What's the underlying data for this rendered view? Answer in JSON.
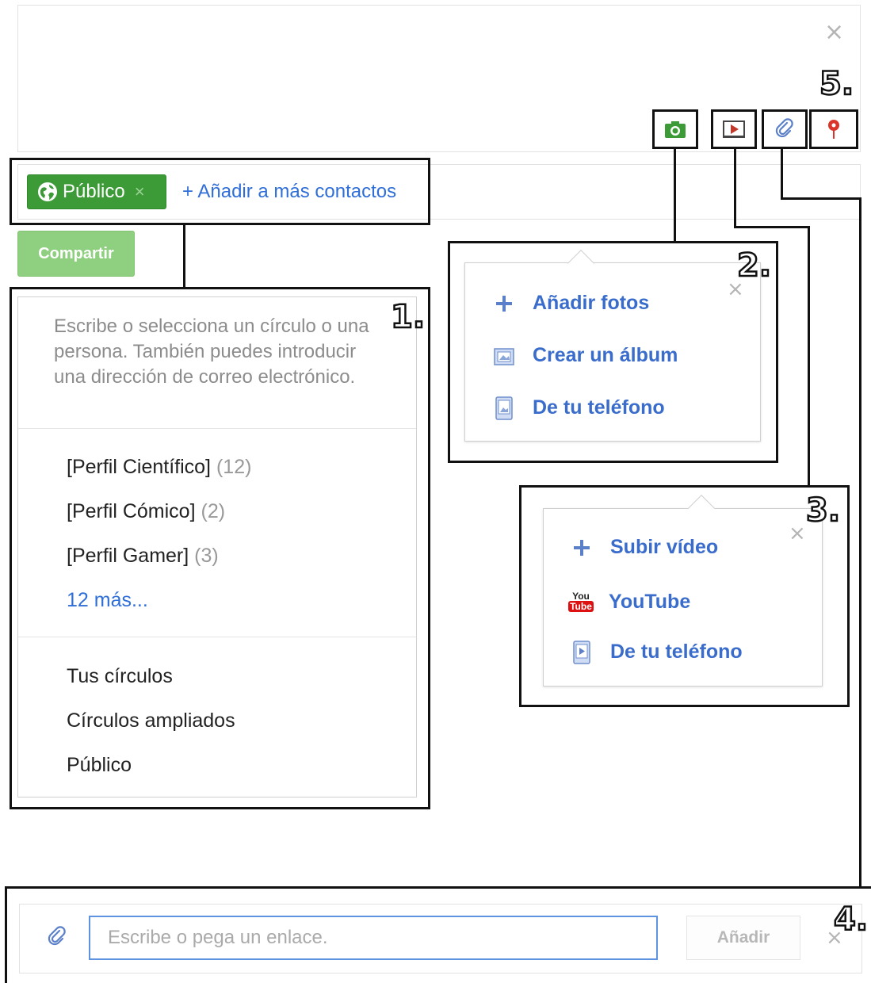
{
  "compose": {
    "close_symbol": "×",
    "toolbar": [
      {
        "name": "camera",
        "icon": "camera-icon",
        "color": "#3c9a37"
      },
      {
        "name": "video",
        "icon": "video-icon",
        "color": "#c0392b"
      },
      {
        "name": "link",
        "icon": "link-icon",
        "color": "#5b80c9"
      },
      {
        "name": "location",
        "icon": "location-pin-icon",
        "color": "#d9352b"
      }
    ]
  },
  "share": {
    "public_chip_label": "Público",
    "public_chip_remove": "×",
    "add_contacts_label": "+ Añadir a más contactos",
    "share_button_label": "Compartir"
  },
  "panel1": {
    "numeral": "1.",
    "hint": "Escribe o selecciona un círculo o una persona. También puedes introducir una dirección de correo electrónico.",
    "circles": [
      {
        "name": "[Perfil Científico]",
        "count": "(12)"
      },
      {
        "name": "[Perfil Cómico]",
        "count": "(2)"
      },
      {
        "name": "[Perfil Gamer]",
        "count": "(3)"
      }
    ],
    "more_link": "12 más...",
    "options": [
      "Tus círculos",
      "Círculos ampliados",
      "Público"
    ]
  },
  "panel2": {
    "numeral": "2.",
    "close_symbol": "×",
    "items": [
      "Añadir fotos",
      "Crear un álbum",
      "De tu teléfono"
    ]
  },
  "panel3": {
    "numeral": "3.",
    "close_symbol": "×",
    "items": [
      "Subir vídeo",
      "YouTube",
      "De tu teléfono"
    ],
    "youtube_logo_top": "You",
    "youtube_logo_bottom": "Tube"
  },
  "panel4": {
    "numeral": "4.",
    "placeholder": "Escribe o pega un enlace.",
    "add_button_label": "Añadir",
    "close_symbol": "×"
  },
  "panel5": {
    "numeral": "5."
  },
  "colors": {
    "accent_blue": "#2f6ed8",
    "public_green": "#3c9a37",
    "share_green": "#8fcf80",
    "annotation_black": "#111111"
  }
}
